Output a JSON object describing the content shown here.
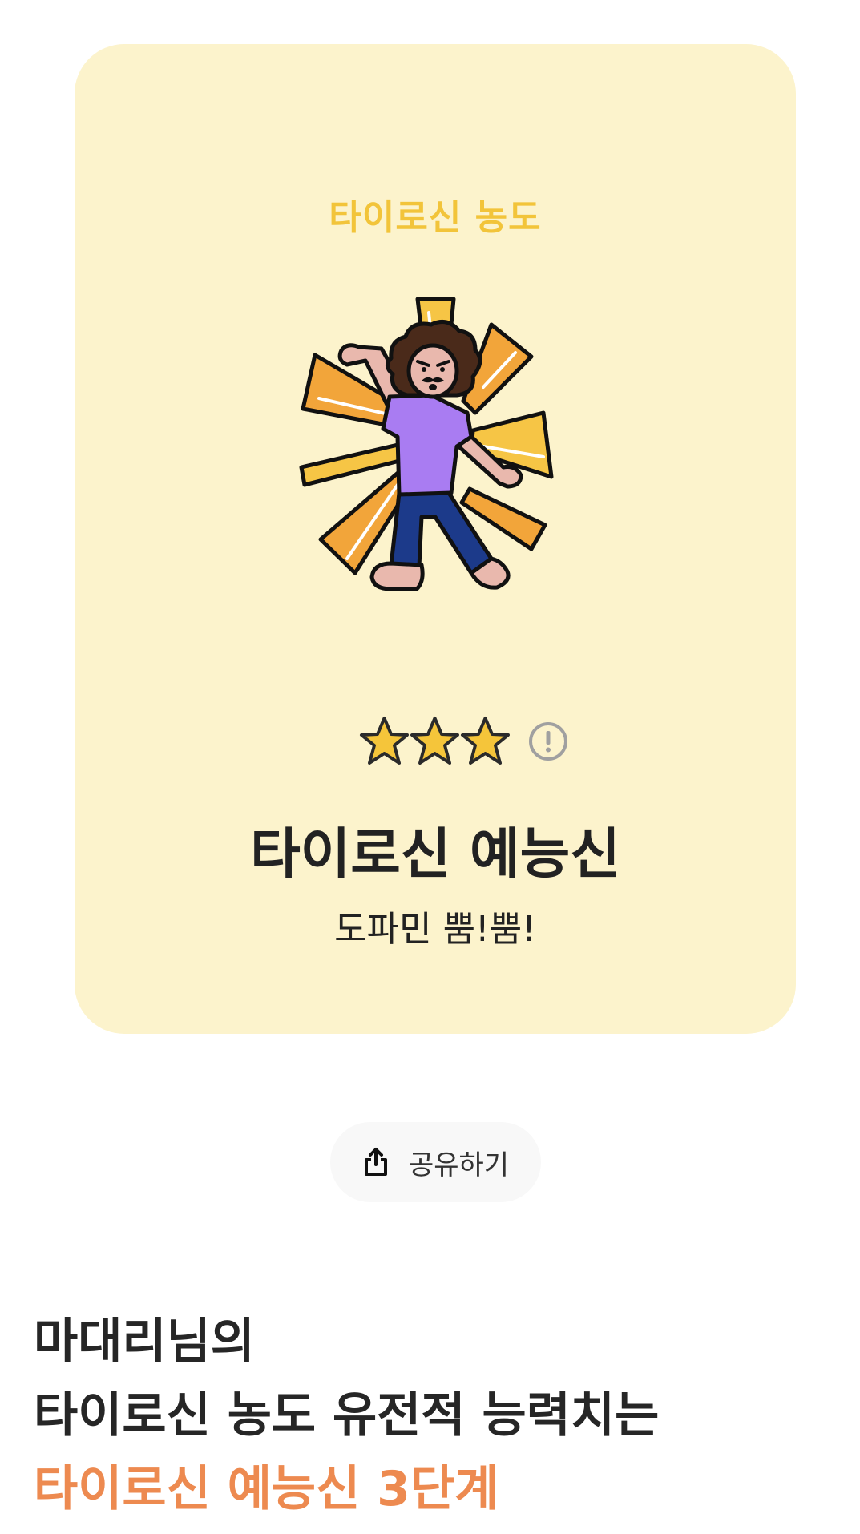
{
  "card": {
    "label": "타이로신 농도",
    "title": "타이로신 예능신",
    "subtitle": "도파민 뿜!뿜!",
    "rating": {
      "stars": 3,
      "max": 3,
      "star_icon": "star-icon",
      "info_icon": "info-icon"
    },
    "illustration": "dancing-person-illustration"
  },
  "share": {
    "label": "공유하기",
    "icon": "share-icon"
  },
  "result": {
    "line1": "마대리님의",
    "line2": "타이로신 농도 유전적 능력치는",
    "line3": "타이로신 예능신 3단계"
  },
  "colors": {
    "card_background": "#fcf3cc",
    "accent_yellow": "#f2c43a",
    "accent_orange": "#ed8a50",
    "star_fill": "#f5c53a"
  }
}
